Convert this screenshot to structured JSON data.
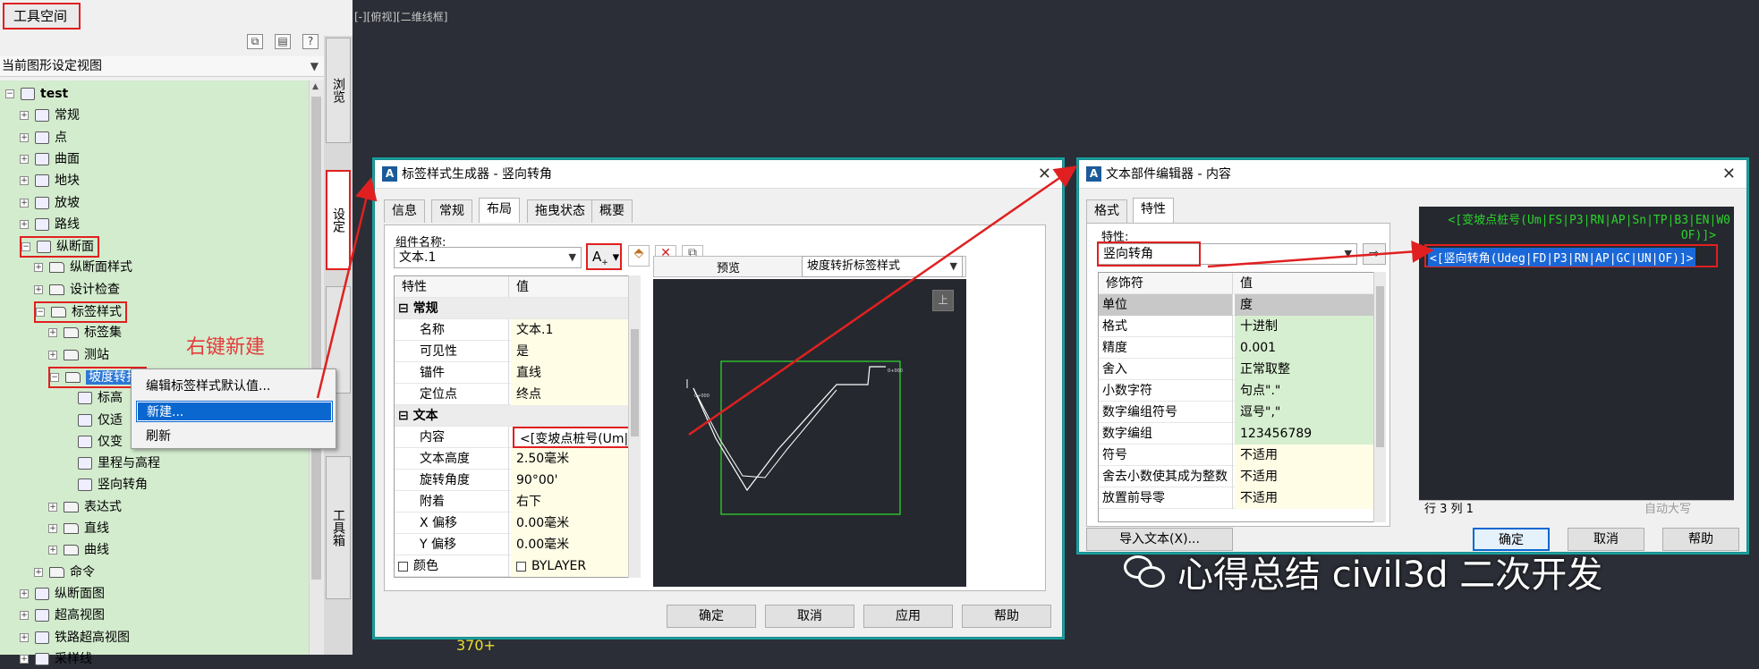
{
  "toolspace": {
    "title": "工具空间",
    "view_selector": "当前图形设定视图",
    "side_tabs": [
      "浏览",
      "设定",
      "工具箱"
    ],
    "tree": [
      {
        "label": "test",
        "level": 0
      },
      {
        "label": "常规",
        "level": 1
      },
      {
        "label": "点",
        "level": 1
      },
      {
        "label": "曲面",
        "level": 1
      },
      {
        "label": "地块",
        "level": 1
      },
      {
        "label": "放坡",
        "level": 1
      },
      {
        "label": "路线",
        "level": 1
      },
      {
        "label": "纵断面",
        "level": 1
      },
      {
        "label": "纵断面样式",
        "level": 2
      },
      {
        "label": "设计检查",
        "level": 2
      },
      {
        "label": "标签样式",
        "level": 2
      },
      {
        "label": "标签集",
        "level": 3
      },
      {
        "label": "测站",
        "level": 3
      },
      {
        "label": "坡度转折",
        "level": 3
      },
      {
        "label": "标高",
        "level": 4
      },
      {
        "label": "仅适",
        "level": 4
      },
      {
        "label": "仅变",
        "level": 4
      },
      {
        "label": "里程与高程",
        "level": 4
      },
      {
        "label": "竖向转角",
        "level": 4
      },
      {
        "label": "表达式",
        "level": 3
      },
      {
        "label": "直线",
        "level": 3
      },
      {
        "label": "曲线",
        "level": 3
      },
      {
        "label": "命令",
        "level": 2
      },
      {
        "label": "纵断面图",
        "level": 1
      },
      {
        "label": "超高视图",
        "level": 1
      },
      {
        "label": "铁路超高视图",
        "level": 1
      },
      {
        "label": "采样线",
        "level": 1
      }
    ]
  },
  "context_menu": {
    "items": [
      "编辑标签样式默认值...",
      "新建...",
      "刷新"
    ],
    "annotation": "右键新建"
  },
  "viewport": {
    "label": "[-][俯视][二维线框]",
    "bottom_text": "370+"
  },
  "label_dialog": {
    "title": "标签样式生成器 - 竖向转角",
    "tabs": [
      "信息",
      "常规",
      "布局",
      "拖曳状态",
      "概要"
    ],
    "component_name_label": "组件名称:",
    "component_name": "文本.1",
    "preview_label": "预览",
    "preview_style": "坡度转折标签样式",
    "grid_headers": [
      "特性",
      "值"
    ],
    "rows": [
      {
        "k": "常规",
        "v": "",
        "cat": true
      },
      {
        "k": "名称",
        "v": "文本.1"
      },
      {
        "k": "可见性",
        "v": "是"
      },
      {
        "k": "锚件",
        "v": "直线"
      },
      {
        "k": "定位点",
        "v": "终点"
      },
      {
        "k": "文本",
        "v": "",
        "cat": true
      },
      {
        "k": "内容",
        "v": "<[变坡点桩号(Um|FS|P..."
      },
      {
        "k": "文本高度",
        "v": "2.50毫米"
      },
      {
        "k": "旋转角度",
        "v": "90°00'"
      },
      {
        "k": "附着",
        "v": "右下"
      },
      {
        "k": "X 偏移",
        "v": "0.00毫米"
      },
      {
        "k": "Y 偏移",
        "v": "0.00毫米"
      },
      {
        "k": "颜色",
        "v": "BYLAYER"
      }
    ],
    "buttons": [
      "确定",
      "取消",
      "应用",
      "帮助"
    ],
    "preview_top_btn": "上"
  },
  "text_dialog": {
    "title": "文本部件编辑器 - 内容",
    "tabs": [
      "格式",
      "特性"
    ],
    "property_label": "特性:",
    "property_value": "竖向转角",
    "grid_headers": [
      "修饰符",
      "值"
    ],
    "rows": [
      {
        "k": "单位",
        "v": "度"
      },
      {
        "k": "格式",
        "v": "十进制"
      },
      {
        "k": "精度",
        "v": "0.001"
      },
      {
        "k": "舍入",
        "v": "正常取整"
      },
      {
        "k": "小数字符",
        "v": "句点\".\""
      },
      {
        "k": "数字编组符号",
        "v": "逗号\",\""
      },
      {
        "k": "数字编组",
        "v": "123456789"
      },
      {
        "k": "符号",
        "v": "不适用"
      },
      {
        "k": "舍去小数使其成为整数",
        "v": "不适用"
      },
      {
        "k": "放置前导零",
        "v": "不适用"
      }
    ],
    "editor_line1": "<[变坡点桩号(Um|FS|P3|RN|AP|Sn|TP|B3|EN|W0",
    "editor_line2": "OF)]>",
    "editor_line3": "<[竖向转角(Udeg|FD|P3|RN|AP|GC|UN|OF)]>",
    "status_left": "行 3 列 1",
    "status_right": "自动大写",
    "import_btn": "导入文本(X)...",
    "buttons": [
      "确定",
      "取消",
      "帮助"
    ]
  },
  "watermark": "心得总结 civil3d 二次开发",
  "colors": {
    "highlight_red": "#e02020",
    "selection_blue": "#0a67d0",
    "tree_bg": "#d3ecce",
    "cad_bg": "#2b2e36",
    "editor_bg": "#2b2e36"
  }
}
